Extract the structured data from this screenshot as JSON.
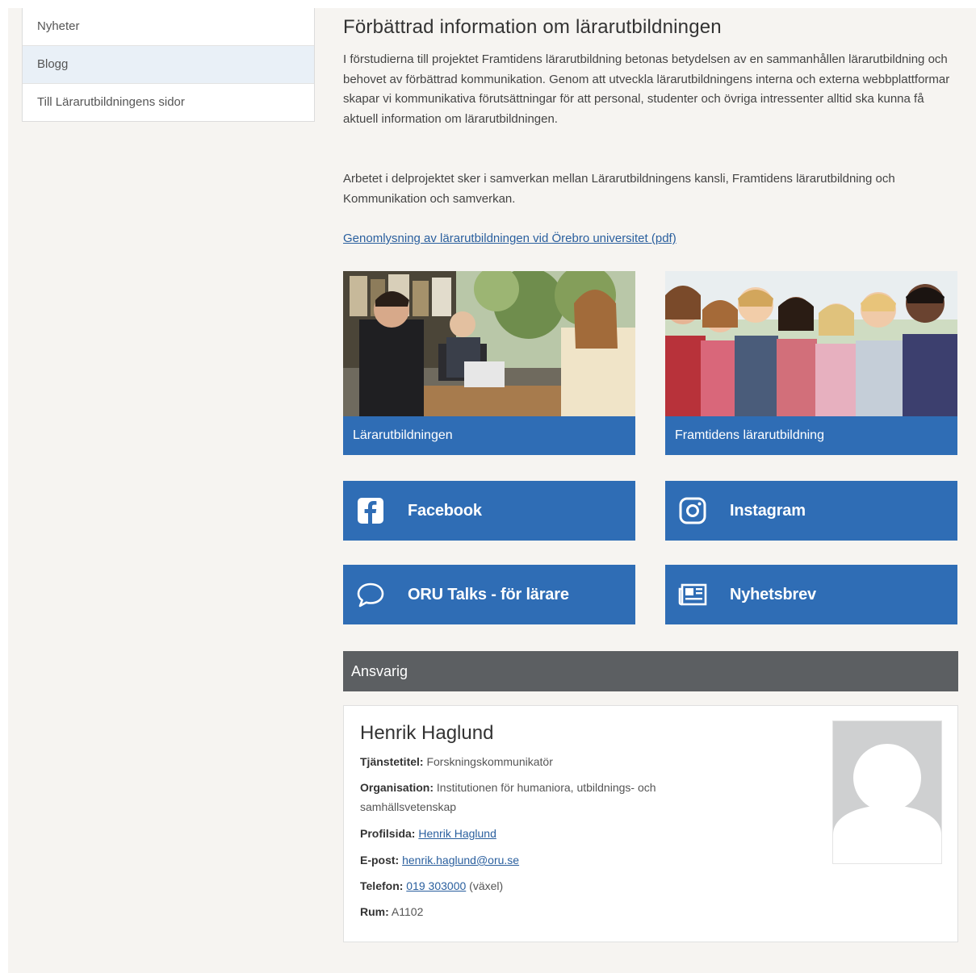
{
  "sidebar": {
    "items": [
      {
        "label": "Nyheter"
      },
      {
        "label": "Blogg"
      },
      {
        "label": "Till Lärarutbildningens sidor"
      }
    ]
  },
  "main": {
    "title": "Förbättrad information om lärarutbildningen",
    "paragraph1": "I förstudierna till projektet Framtidens lärarutbildning betonas betydelsen av en sammanhållen lärarutbildning och behovet av förbättrad kommunikation. Genom att utveckla lärarutbildningens interna och externa webbplattformar skapar vi kommunikativa förutsättningar för att personal, studenter och övriga intressenter alltid ska kunna få aktuell information om lärarutbildningen.",
    "paragraph2": "Arbetet i delprojektet sker i samverkan mellan Lärarutbildningens kansli, Framtidens lärarutbildning och Kommunikation och samverkan.",
    "doc_link": "Genomlysning av lärarutbildningen vid Örebro universitet (pdf)",
    "cards": [
      {
        "label": "Lärarutbildningen"
      },
      {
        "label": "Framtidens lärarutbildning"
      }
    ],
    "social": {
      "facebook": {
        "label": "Facebook",
        "icon": "facebook-icon"
      },
      "instagram": {
        "label": "Instagram",
        "icon": "instagram-icon"
      },
      "talks": {
        "label": "ORU Talks - för lärare",
        "icon": "speech-bubble-icon"
      },
      "newsletter": {
        "label": "Nyhetsbrev",
        "icon": "newspaper-icon"
      }
    }
  },
  "responsible": {
    "heading": "Ansvarig",
    "name": "Henrik Haglund",
    "title_label": "Tjänstetitel:",
    "title_value": "Forskningskommunikatör",
    "org_label": "Organisation:",
    "org_value": "Institutionen för humaniora, utbildnings- och samhällsvetenskap",
    "profile_label": "Profilsida:",
    "profile_value": "Henrik Haglund",
    "email_label": "E-post:",
    "email_value": "henrik.haglund@oru.se",
    "phone_label": "Telefon:",
    "phone_value": "019 303000",
    "phone_suffix": "(växel)",
    "room_label": "Rum:",
    "room_value": "A1102"
  },
  "colors": {
    "accent_blue": "#2f6db5",
    "header_gray": "#5c5f62",
    "page_bg": "#f6f4f1",
    "link": "#2a5f9e"
  }
}
